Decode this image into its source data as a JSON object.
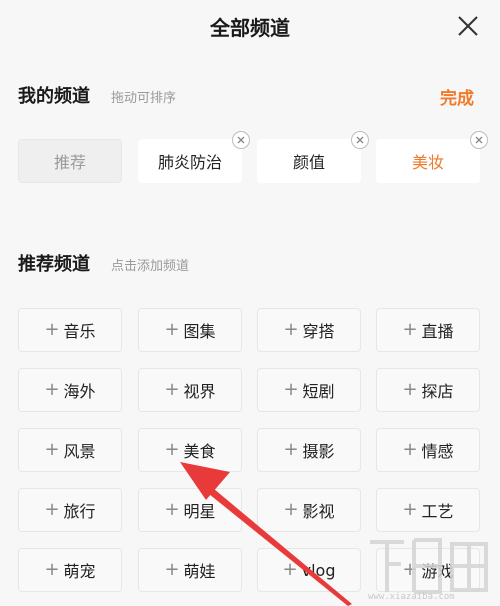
{
  "header": {
    "title": "全部频道"
  },
  "my_channels": {
    "title": "我的频道",
    "hint": "拖动可排序",
    "done_label": "完成",
    "items": [
      {
        "label": "推荐",
        "removable": false,
        "style": "muted"
      },
      {
        "label": "肺炎防治",
        "removable": true,
        "style": "normal"
      },
      {
        "label": "颜值",
        "removable": true,
        "style": "normal"
      },
      {
        "label": "美妆",
        "removable": true,
        "style": "active"
      }
    ]
  },
  "recommended": {
    "title": "推荐频道",
    "hint": "点击添加频道",
    "items": [
      "音乐",
      "图集",
      "穿搭",
      "直播",
      "海外",
      "视界",
      "短剧",
      "探店",
      "风景",
      "美食",
      "摄影",
      "情感",
      "旅行",
      "明星",
      "影视",
      "工艺",
      "萌宠",
      "萌娃",
      "vlog",
      "游戏"
    ]
  },
  "colors": {
    "accent": "#f07a2a",
    "annotation_arrow": "#e83a3a"
  },
  "icons": {
    "close": "close-icon",
    "remove": "remove-x-icon",
    "add": "plus-icon"
  },
  "watermark": {
    "text": "www.xiazaiba.com",
    "logo_text": "下载吧"
  }
}
